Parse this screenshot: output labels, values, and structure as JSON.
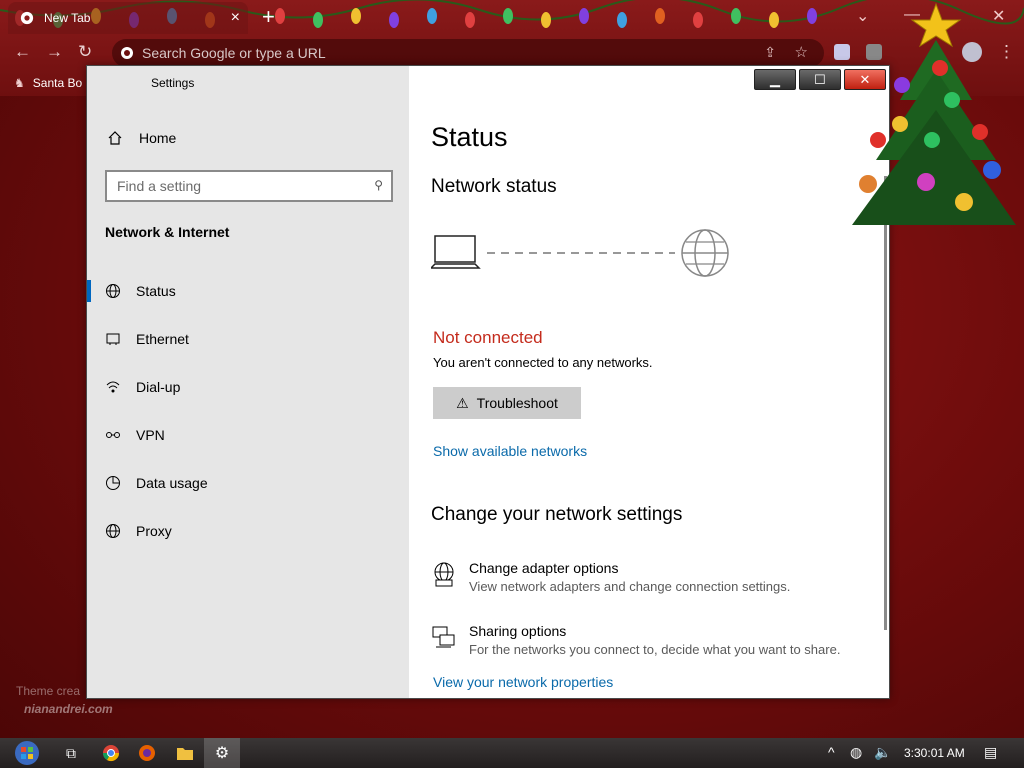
{
  "browser": {
    "tab_title": "New Tab",
    "omnibox_placeholder": "Search Google or type a URL",
    "bookmark_label": "Santa Bo"
  },
  "settings": {
    "window_title": "Settings",
    "home_label": "Home",
    "search_placeholder": "Find a setting",
    "section_header": "Network & Internet",
    "nav": [
      {
        "label": "Status",
        "icon": "globe-icon"
      },
      {
        "label": "Ethernet",
        "icon": "ethernet-icon"
      },
      {
        "label": "Dial-up",
        "icon": "dialup-icon"
      },
      {
        "label": "VPN",
        "icon": "vpn-icon"
      },
      {
        "label": "Data usage",
        "icon": "data-usage-icon"
      },
      {
        "label": "Proxy",
        "icon": "globe-icon"
      }
    ],
    "active_nav": "Status"
  },
  "main": {
    "page_title": "Status",
    "network_status_heading": "Network status",
    "connection_state": "Not connected",
    "connection_desc": "You aren't connected to any networks.",
    "troubleshoot_label": "Troubleshoot",
    "show_networks_link": "Show available networks",
    "change_heading": "Change your network settings",
    "adapter_title": "Change adapter options",
    "adapter_desc": "View network adapters and change connection settings.",
    "sharing_title": "Sharing options",
    "sharing_desc": "For the networks you connect to, decide what you want to share.",
    "properties_link": "View your network properties"
  },
  "desktop": {
    "watermark_line1": "Theme crea",
    "watermark_line2": "nianandrei.com"
  },
  "taskbar": {
    "clock": "3:30:01 AM"
  },
  "colors": {
    "accent": "#0067c0",
    "error": "#c42b1c",
    "link": "#0a6aaa",
    "sidebar_bg": "#e6e6e6"
  }
}
